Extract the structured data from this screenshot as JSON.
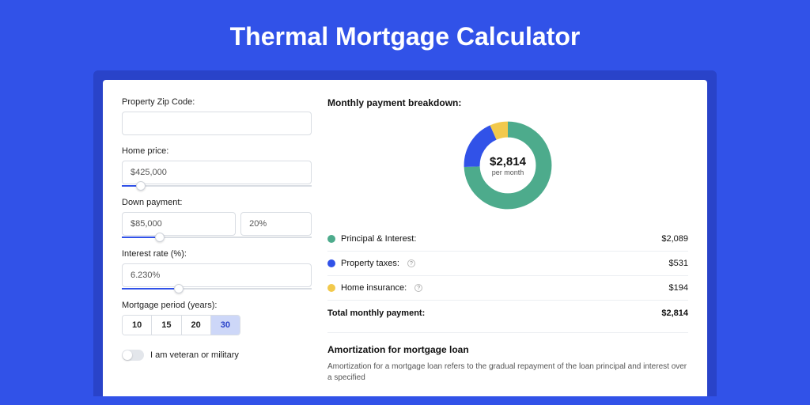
{
  "title": "Thermal Mortgage Calculator",
  "form": {
    "zip_label": "Property Zip Code:",
    "zip_value": "",
    "home_price_label": "Home price:",
    "home_price_value": "$425,000",
    "home_price_slider_pct": 10,
    "down_payment_label": "Down payment:",
    "down_payment_value": "$85,000",
    "down_payment_pct": "20%",
    "down_payment_slider_pct": 20,
    "interest_label": "Interest rate (%):",
    "interest_value": "6.230%",
    "interest_slider_pct": 30,
    "period_label": "Mortgage period (years):",
    "periods": [
      "10",
      "15",
      "20",
      "30"
    ],
    "period_selected": "30",
    "veteran_label": "I am veteran or military"
  },
  "breakdown": {
    "title": "Monthly payment breakdown:",
    "center_amount": "$2,814",
    "center_sub": "per month",
    "items": [
      {
        "label": "Principal & Interest:",
        "value": "$2,089",
        "color": "g"
      },
      {
        "label": "Property taxes:",
        "value": "$531",
        "color": "b",
        "info": true
      },
      {
        "label": "Home insurance:",
        "value": "$194",
        "color": "y",
        "info": true
      }
    ],
    "total_label": "Total monthly payment:",
    "total_value": "$2,814"
  },
  "chart_data": {
    "type": "pie",
    "title": "Monthly payment breakdown",
    "series": [
      {
        "name": "Principal & Interest",
        "value": 2089,
        "color": "#4dab8c"
      },
      {
        "name": "Property taxes",
        "value": 531,
        "color": "#3152e8"
      },
      {
        "name": "Home insurance",
        "value": 194,
        "color": "#f2c94c"
      }
    ],
    "total": 2814
  },
  "amortization": {
    "title": "Amortization for mortgage loan",
    "text": "Amortization for a mortgage loan refers to the gradual repayment of the loan principal and interest over a specified"
  },
  "colors": {
    "accent": "#3152e8",
    "green": "#4dab8c",
    "yellow": "#f2c94c"
  }
}
